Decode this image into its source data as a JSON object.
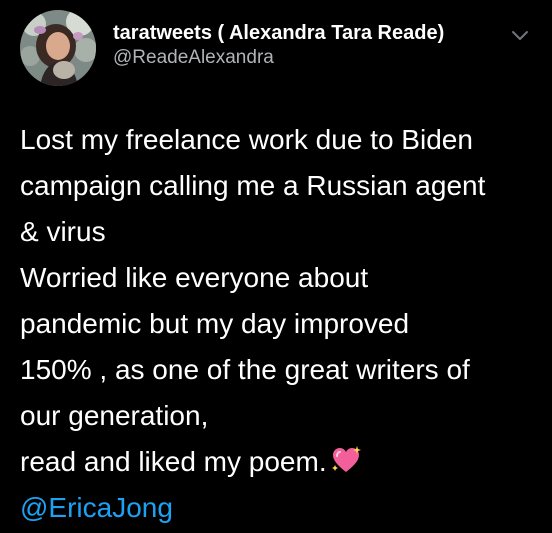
{
  "tweet": {
    "author": {
      "display_name": "taratweets ( Alexandra Tara Reade)",
      "handle": "@ReadeAlexandra"
    },
    "lines": [
      "Lost my freelance work due to Biden",
      "campaign calling me a Russian agent",
      "& virus",
      "Worried like everyone about",
      "pandemic but my day improved",
      "150% , as one of the great writers of",
      "our generation,",
      "read and liked my poem."
    ],
    "emoji": "sparkling-heart-icon",
    "mention": "@EricaJong"
  },
  "colors": {
    "background": "#000000",
    "text": "#ffffff",
    "secondary_text": "#b0b3b8",
    "mention": "#1da1f2"
  }
}
